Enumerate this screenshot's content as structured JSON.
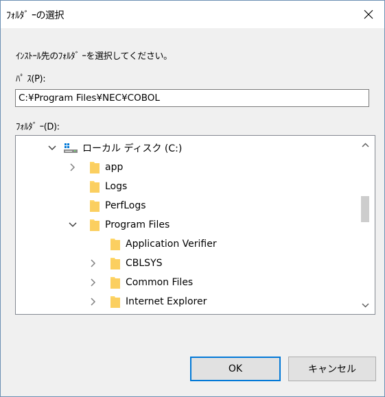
{
  "window": {
    "title": "ﾌｫﾙﾀﾞ ｰの選択"
  },
  "prompt": "ｲﾝｽﾄｰﾙ先のﾌｫﾙﾀﾞ ｰを選択してください。",
  "path": {
    "label": "ﾊﾟ ｽ(P):",
    "value": "C:¥Program Files¥NEC¥COBOL"
  },
  "folders": {
    "label": "ﾌｫﾙﾀﾞ ｰ(D):",
    "items": [
      {
        "label": "ローカル ディスク (C:)",
        "icon": "drive-icon",
        "expander": "expanded"
      },
      {
        "label": "app",
        "icon": "folder-icon",
        "expander": "collapsed"
      },
      {
        "label": "Logs",
        "icon": "folder-icon",
        "expander": "none"
      },
      {
        "label": "PerfLogs",
        "icon": "folder-icon",
        "expander": "none"
      },
      {
        "label": "Program Files",
        "icon": "folder-icon",
        "expander": "expanded"
      },
      {
        "label": "Application Verifier",
        "icon": "folder-icon",
        "expander": "none"
      },
      {
        "label": "CBLSYS",
        "icon": "folder-icon",
        "expander": "collapsed"
      },
      {
        "label": "Common Files",
        "icon": "folder-icon",
        "expander": "collapsed"
      },
      {
        "label": "Internet Explorer",
        "icon": "folder-icon",
        "expander": "collapsed"
      }
    ]
  },
  "buttons": {
    "ok": "OK",
    "cancel": "キャンセル"
  },
  "colors": {
    "accent": "#0078d7",
    "folder": "#ffd767",
    "window_border": "#6b8fb3"
  }
}
